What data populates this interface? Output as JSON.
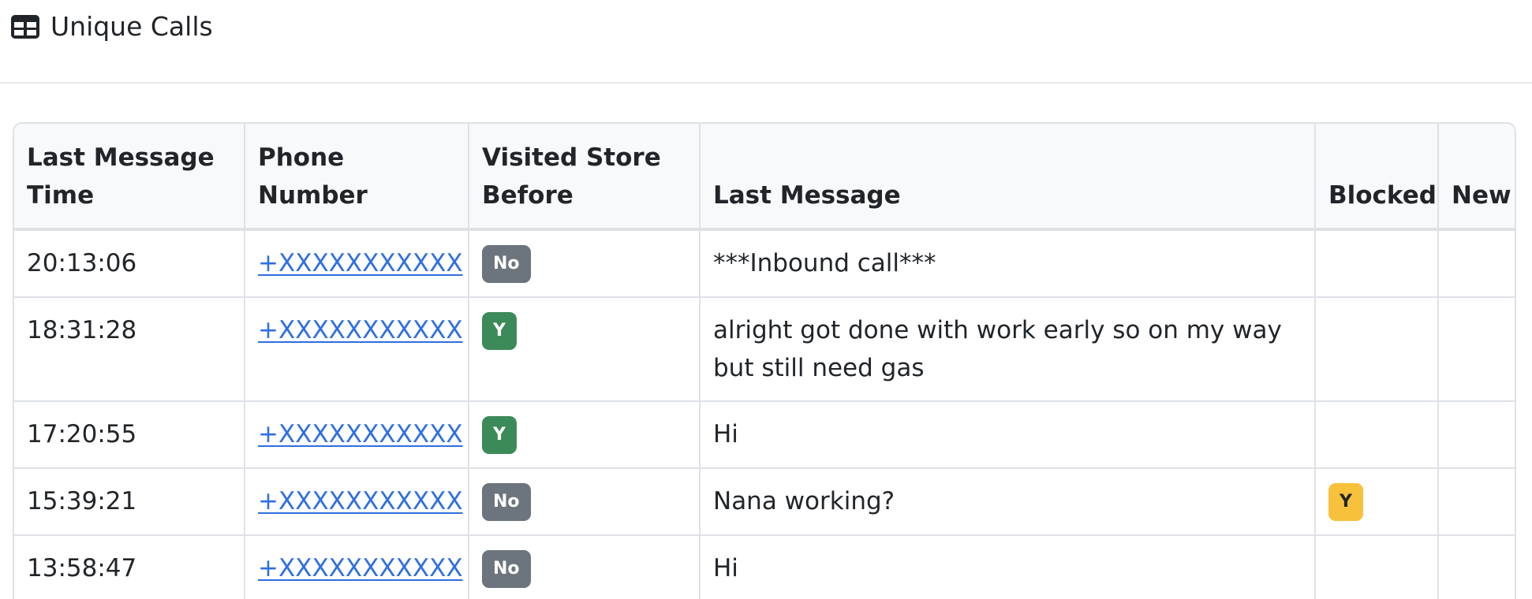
{
  "header": {
    "icon": "table-icon",
    "title": "Unique Calls"
  },
  "table": {
    "columns": [
      "Last Message Time",
      "Phone Number",
      "Visited Store Before",
      "Last Message",
      "Blocked",
      "New"
    ],
    "rows": [
      {
        "time": "20:13:06",
        "phone": "+XXXXXXXXXXX",
        "visited": "No",
        "message": "***Inbound call***",
        "blocked": "",
        "new": ""
      },
      {
        "time": "18:31:28",
        "phone": "+XXXXXXXXXXX",
        "visited": "Y",
        "message": "alright got done with work early so on my way but still need gas",
        "blocked": "",
        "new": ""
      },
      {
        "time": "17:20:55",
        "phone": "+XXXXXXXXXXX",
        "visited": "Y",
        "message": "Hi",
        "blocked": "",
        "new": ""
      },
      {
        "time": "15:39:21",
        "phone": "+XXXXXXXXXXX",
        "visited": "No",
        "message": "Nana working?",
        "blocked": "Y",
        "new": ""
      },
      {
        "time": "13:58:47",
        "phone": "+XXXXXXXXXXX",
        "visited": "No",
        "message": "Hi",
        "blocked": "",
        "new": ""
      }
    ]
  },
  "colors": {
    "link": "#2f6fe0",
    "badge_no": "#6c757d",
    "badge_yes": "#3c8a58",
    "badge_blocked": "#f7c13b",
    "header_background": "#f8f9fa",
    "border": "#dee2e6"
  }
}
